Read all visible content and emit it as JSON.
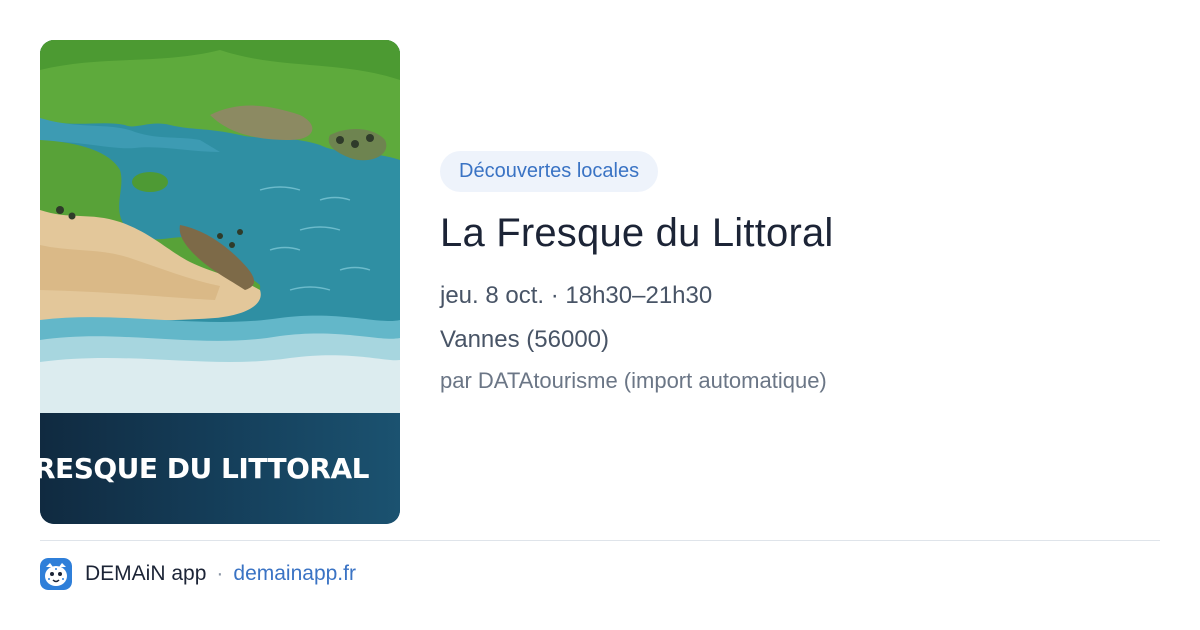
{
  "event": {
    "banner_text": "RESQUE DU LITTORAL",
    "category": "Découvertes locales",
    "title": "La Fresque du Littoral",
    "date_time": "jeu. 8 oct. · 18h30–21h30",
    "location": "Vannes (56000)",
    "source": "par DATAtourisme (import automatique)"
  },
  "footer": {
    "app_icon": "leopard-face-icon",
    "app_name": "DEMAiN app",
    "separator": "·",
    "domain": "demainapp.fr"
  },
  "colors": {
    "chip_background": "#eef3fb",
    "accent": "#3a73c4",
    "title": "#1c2436",
    "banner": "#15405c"
  }
}
